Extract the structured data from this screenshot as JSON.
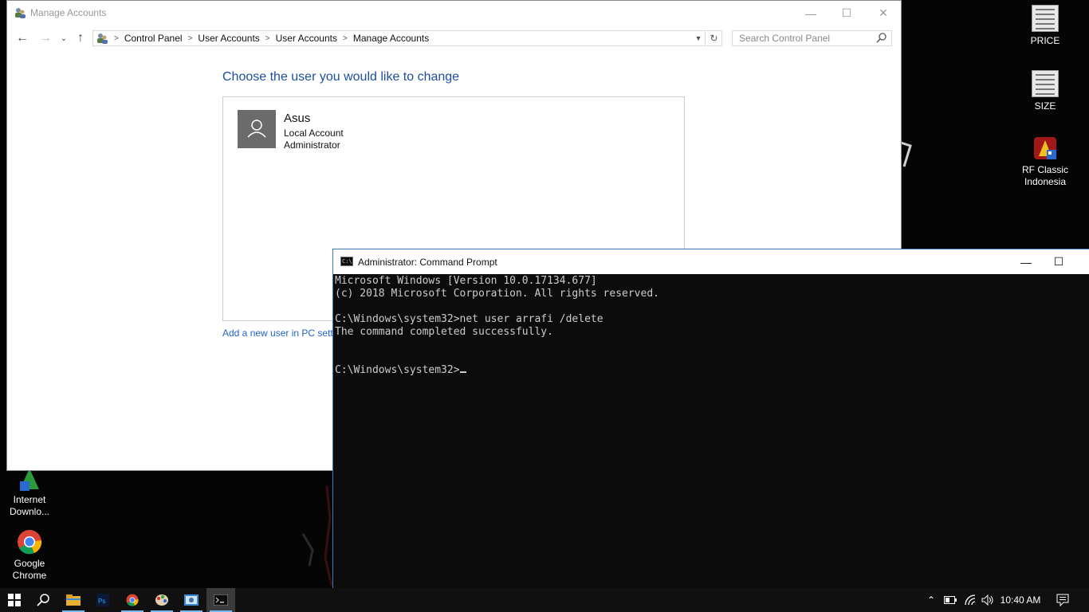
{
  "desktop": {
    "icons": [
      {
        "label": "PRICE"
      },
      {
        "label": "SIZE"
      },
      {
        "label": "RF Classic Indonesia"
      },
      {
        "label": "Internet Downlo..."
      },
      {
        "label": "Google Chrome"
      }
    ]
  },
  "control_panel": {
    "window_title": "Manage Accounts",
    "breadcrumbs": [
      "Control Panel",
      "User Accounts",
      "User Accounts",
      "Manage Accounts"
    ],
    "search_placeholder": "Search Control Panel",
    "heading": "Choose the user you would like to change",
    "user": {
      "name": "Asus",
      "type": "Local Account",
      "role": "Administrator"
    },
    "add_user_link": "Add a new user in PC setti"
  },
  "cmd": {
    "title": "Administrator: Command Prompt",
    "lines": [
      "Microsoft Windows [Version 10.0.17134.677]",
      "(c) 2018 Microsoft Corporation. All rights reserved.",
      "",
      "C:\\Windows\\system32>net user arrafi /delete",
      "The command completed successfully.",
      "",
      "",
      "C:\\Windows\\system32>"
    ]
  },
  "taskbar": {
    "clock": "10:40 AM",
    "apps": [
      "start",
      "search",
      "file-explorer",
      "photoshop",
      "chrome",
      "paint",
      "control-panel",
      "command-prompt"
    ]
  },
  "colors": {
    "accent": "#1e4fa0",
    "link": "#1e64c8",
    "console_bg": "#0c0c0c",
    "console_fg": "#cccccc",
    "taskbar_highlight": "#76b9ed"
  }
}
